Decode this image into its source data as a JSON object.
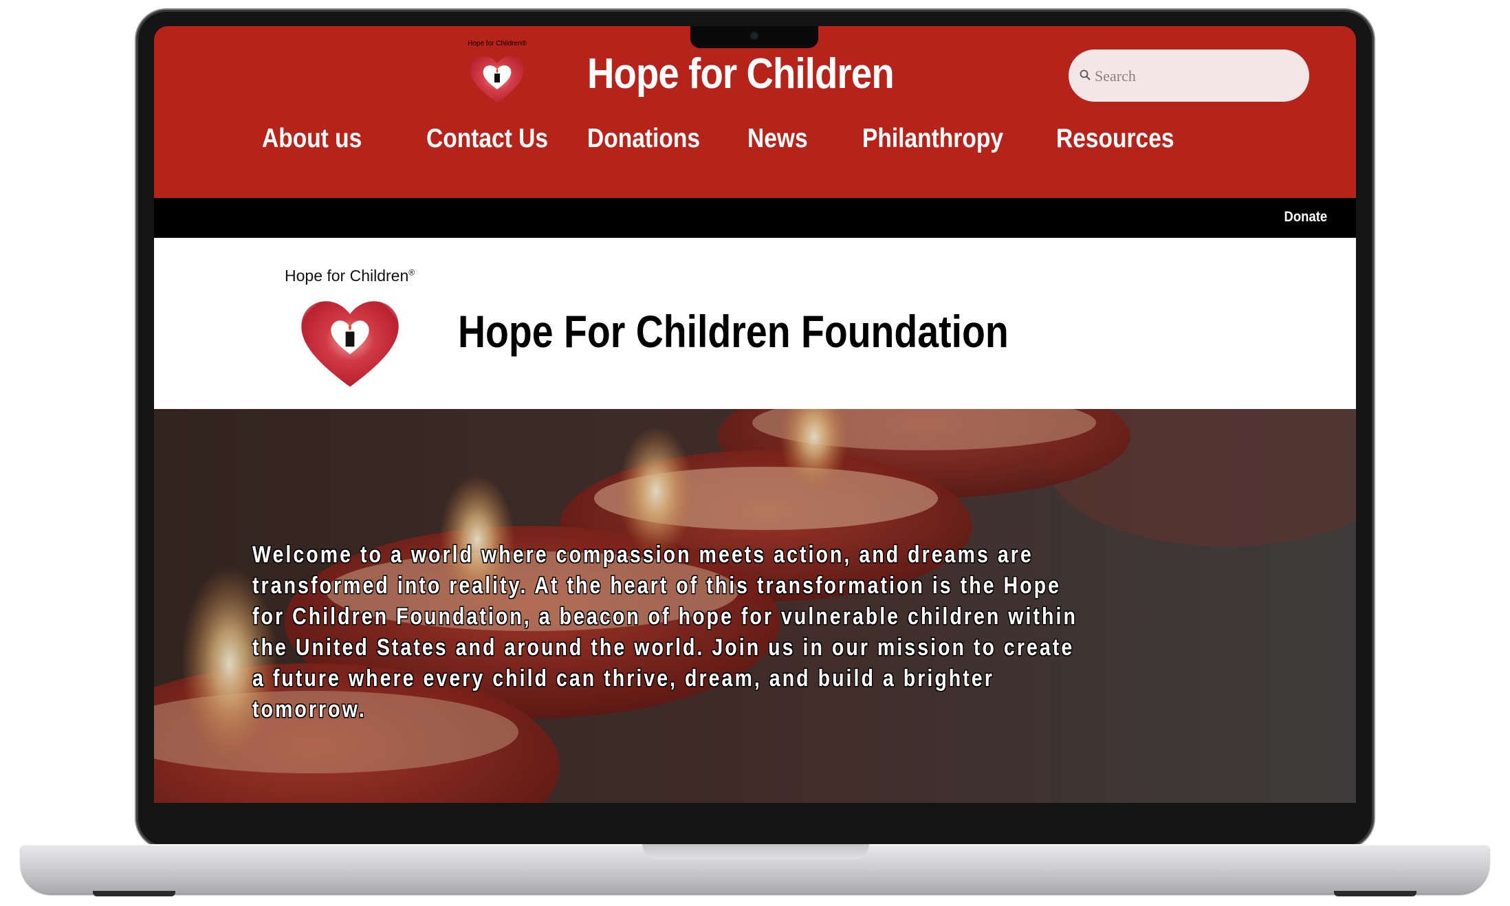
{
  "header": {
    "logo_caption": "Hope for Children®",
    "site_title": "Hope for Children",
    "search_placeholder": "Search"
  },
  "nav": {
    "items": [
      {
        "label": "About us"
      },
      {
        "label": "Contact Us"
      },
      {
        "label": "Donations"
      },
      {
        "label": "News"
      },
      {
        "label": "Philanthropy"
      },
      {
        "label": "Resources"
      }
    ]
  },
  "utility_bar": {
    "donate_label": "Donate"
  },
  "brand_band": {
    "logo_caption": "Hope for Children",
    "registered_mark": "®",
    "title": "Hope For Children Foundation"
  },
  "hero": {
    "text": "Welcome to a world where compassion meets action, and dreams are transformed into reality. At the heart of this transformation is the Hope for Children Foundation, a beacon of hope for vulnerable children within the United States and around the world. Join us in our mission to create a future where every child can thrive, dream, and build a brighter tomorrow."
  },
  "colors": {
    "header_red": "#b5231b",
    "search_bg": "#f4e6e6",
    "bar_black": "#000000",
    "text_white": "#ffffff"
  },
  "icons": {
    "logo": "heart-candle-icon",
    "search": "search-icon"
  }
}
